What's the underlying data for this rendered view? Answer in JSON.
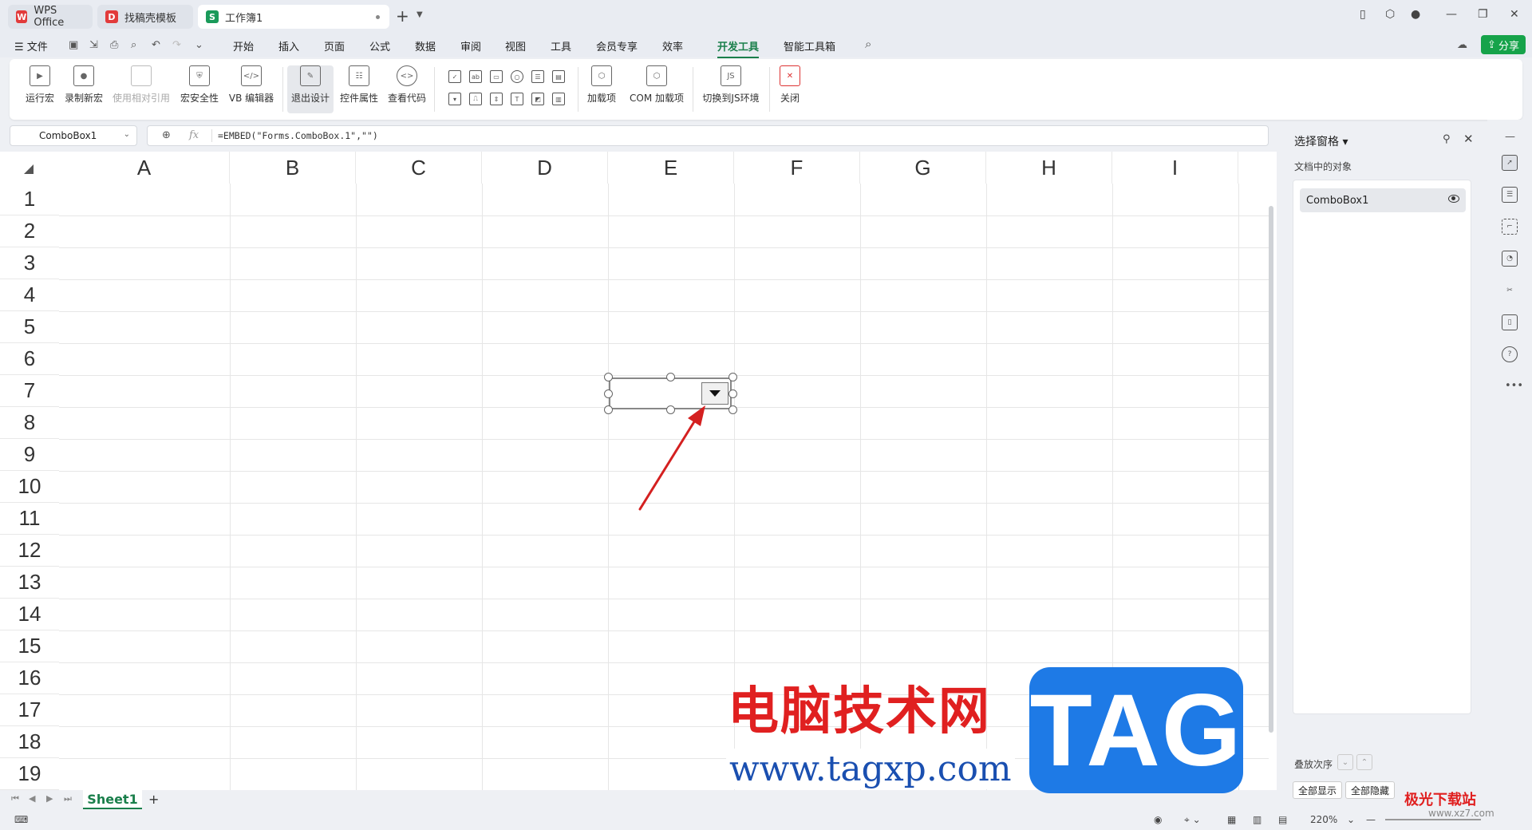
{
  "tabs": [
    {
      "label": "WPS Office"
    },
    {
      "label": "找稿壳模板"
    },
    {
      "label": "工作簿1"
    }
  ],
  "menu": {
    "file": "文件",
    "items": [
      "开始",
      "插入",
      "页面",
      "公式",
      "数据",
      "审阅",
      "视图",
      "工具",
      "会员专享",
      "效率",
      "开发工具",
      "智能工具箱"
    ],
    "active": "开发工具",
    "share": "分享"
  },
  "ribbon": {
    "run_macro": "运行宏",
    "record_macro": "录制新宏",
    "relative_ref": "使用相对引用",
    "macro_security": "宏安全性",
    "vb_editor": "VB 编辑器",
    "exit_design": "退出设计",
    "control_props": "控件属性",
    "view_code": "查看代码",
    "addins": "加载项",
    "com_addins": "COM 加载项",
    "switch_js": "切换到JS环境",
    "close": "关闭",
    "js_icon_text": "JS"
  },
  "formula": {
    "name_box": "ComboBox1",
    "fx": "fx",
    "content": "=EMBED(\"Forms.ComboBox.1\",\"\")"
  },
  "grid": {
    "columns": [
      "A",
      "B",
      "C",
      "D",
      "E",
      "F",
      "G",
      "H",
      "I"
    ],
    "rows": [
      "1",
      "2",
      "3",
      "4",
      "5",
      "6",
      "7",
      "8",
      "9",
      "10",
      "11",
      "12",
      "13",
      "14",
      "15",
      "16",
      "17",
      "18",
      "19"
    ]
  },
  "sheets": {
    "active": "Sheet1",
    "add": "+"
  },
  "status": {
    "zoom": "220%"
  },
  "selection_pane": {
    "title": "选择窗格",
    "subtitle": "文档中的对象",
    "items": [
      {
        "label": "ComboBox1"
      }
    ],
    "order_label": "叠放次序",
    "show_all": "全部显示",
    "hide_all": "全部隐藏"
  },
  "watermark": {
    "cn": "电脑技术网",
    "url": "www.tagxp.com",
    "tag": "TAG",
    "site2": "极光下载站",
    "site2_url": "www.xz7.com"
  },
  "colors": {
    "accent": "#1a7f4b",
    "share": "#16a34a",
    "arrow": "#d42020"
  }
}
